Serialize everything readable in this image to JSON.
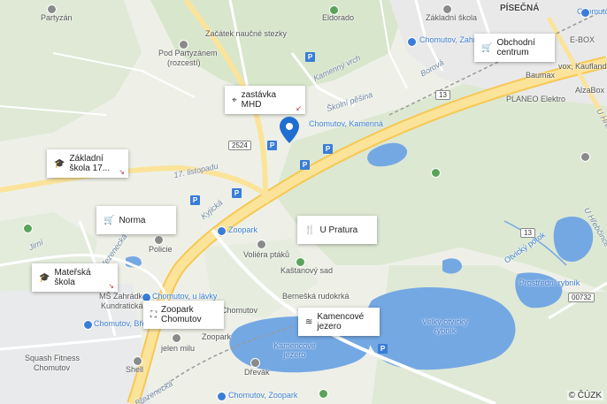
{
  "map": {
    "attribution": "© ČÚZK",
    "cards": [
      {
        "name": "card-zastavka-mhd",
        "icon": "location-icon",
        "glyph": "⌖",
        "label": "zastávka MHD"
      },
      {
        "name": "card-obchodni-centrum",
        "icon": "cart-icon",
        "glyph": "🛒",
        "label": "Obchodní centrum"
      },
      {
        "name": "card-zakladni-skola",
        "icon": "school-icon",
        "glyph": "🎓",
        "label": "Základní škola 17..."
      },
      {
        "name": "card-norma",
        "icon": "cart-icon",
        "glyph": "🛒",
        "label": "Norma"
      },
      {
        "name": "card-u-pratura",
        "icon": "restaurant-icon",
        "glyph": "🍴",
        "label": "U Pratura"
      },
      {
        "name": "card-materska-skola",
        "icon": "school-icon",
        "glyph": "🎓",
        "label": "Mateřská škola"
      },
      {
        "name": "card-zoopark",
        "icon": "sitemap-icon",
        "glyph": "⛶",
        "label": "Zoopark Chomutov"
      },
      {
        "name": "card-kamencove-jezero",
        "icon": "beach-icon",
        "glyph": "≋",
        "label": "Kamencové jezero"
      }
    ],
    "labels": {
      "partyzan": "Partyzán",
      "eldorado": "Eldorado",
      "zakladni_skola": "Základní škola",
      "pisecna": "PÍSEČNÁ",
      "chomutov": "Chomutov",
      "zacatek": "Začátek naučné stezky",
      "pod_partyzanem": "Pod Partyzánem",
      "rozcesti": "(rozcestí)",
      "chomutov_zahrad": "Chomutov, Zahrad...",
      "e_box": "E-BOX",
      "vox_kaufland": "vox, Kaufland",
      "baumax": "Baumax",
      "alzabox": "AlzaBox",
      "planeo": "PLANEO Elektro",
      "kamenny_vrch": "Kamenný vrch",
      "borova": "Borová",
      "skolni_pesina": "Školní pěšina",
      "chomutov_kamenna": "Chomutov, Kamenná",
      "road_2524": "2524",
      "road_13a": "13",
      "road_13b": "13",
      "road_00732": "00732",
      "sedmnact_listopadu": "17. listopadu",
      "kyjicka": "Kyjická",
      "zoopark": "Zoopark",
      "voliera": "Voliéra ptáků",
      "kastanovy": "Kaštanový sad",
      "bernesska": "Bernešká rudokrká",
      "policie": "Policie",
      "jirni": "Jirní",
      "brezenecka": "Březenecká",
      "chomutov_u_lavky": "Chomutov, u lávky",
      "ms_zahradka": "MŠ Zahrádka",
      "kundraticka": "Kundratická",
      "chomutov_breze": "Chomutov, Březe...",
      "zoopark2": "Zoopark",
      "chomutov2": "Chomutov",
      "jelen_milu": "jelen milu",
      "squash": "Squash Fitness",
      "squash2": "Chomutov",
      "shell": "Shell",
      "kamencove_jezero": "Kamencové jezero",
      "drevak": "Dřevák",
      "chomutov_zoopark": "Chomutov, Zoopark",
      "velky_otvicky": "Velký otvický rybník",
      "prostredni": "Prostřední rybník",
      "otvicky_potok": "Otvický potok",
      "u_hrebcince": "U Hřebčince",
      "u_hrebcince2": "U Hřebčince",
      "brezenecka2": "Březenecká"
    }
  }
}
